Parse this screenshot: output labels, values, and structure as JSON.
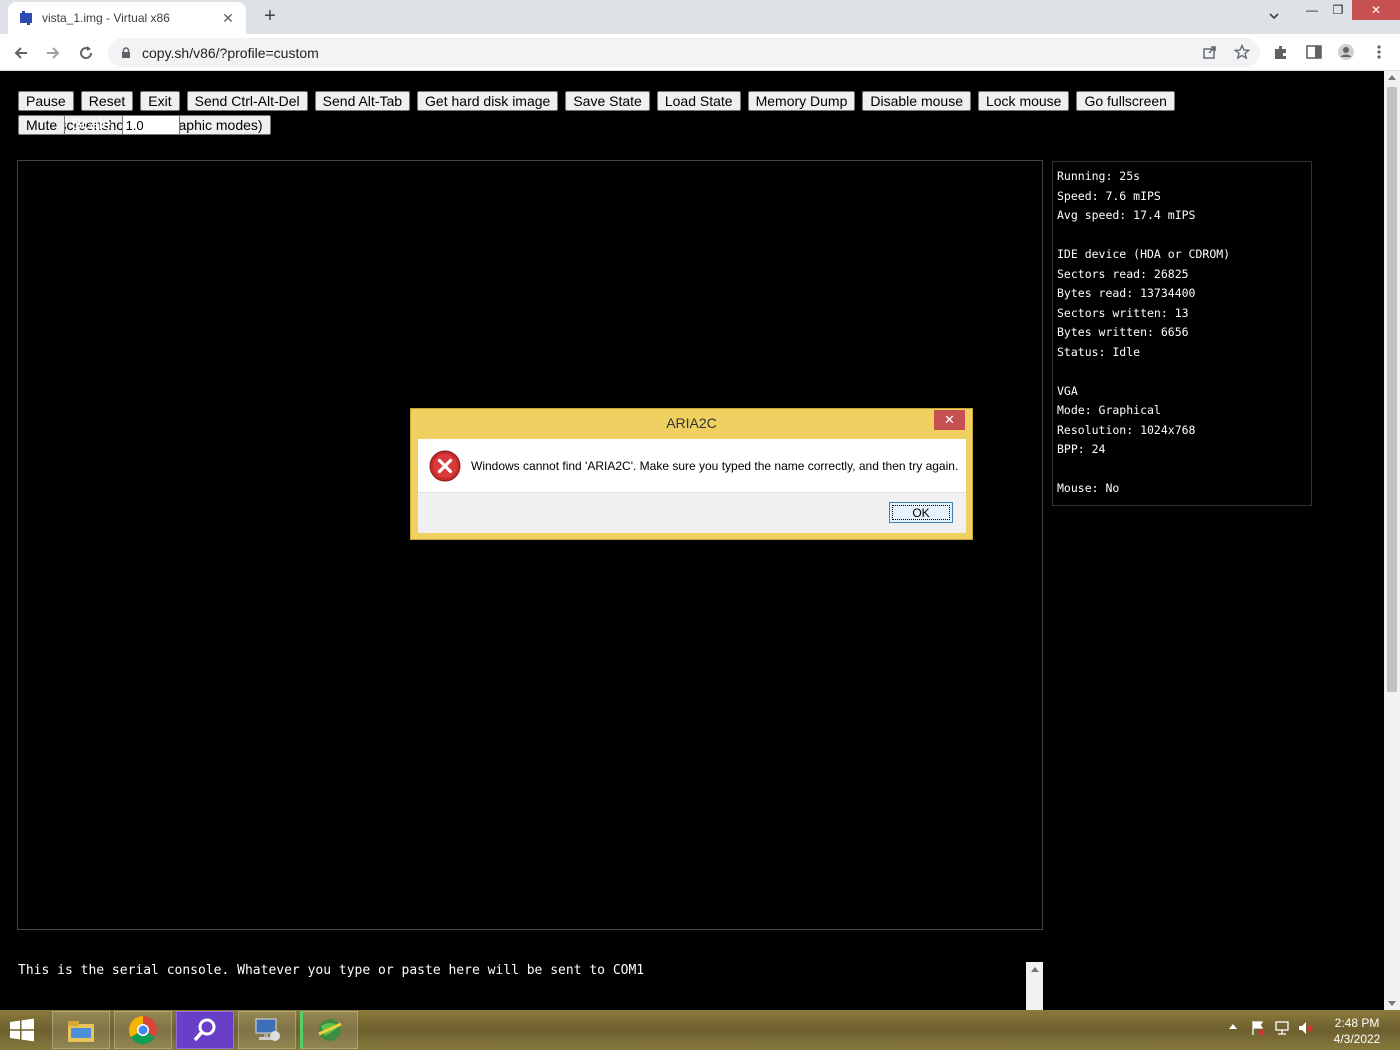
{
  "browser": {
    "tab_title": "vista_1.img - Virtual x86",
    "url": "copy.sh/v86/?profile=custom"
  },
  "emulator": {
    "buttons": [
      "Pause",
      "Reset",
      "Exit",
      "Send Ctrl-Alt-Del",
      "Send Alt-Tab",
      "Get hard disk image",
      "Save State",
      "Load State",
      "Memory Dump",
      "Disable mouse",
      "Lock mouse",
      "Go fullscreen",
      "Take screenshot (only graphic modes)"
    ],
    "mute_label": "Mute",
    "scale_label": "Scale:",
    "scale_value": "1.0"
  },
  "info_panel": {
    "lines": [
      "Running: 25s",
      "Speed: 7.6 mIPS",
      "Avg speed: 17.4 mIPS",
      "",
      "IDE device (HDA or CDROM)",
      "Sectors read: 26825",
      "Bytes read: 13734400",
      "Sectors written: 13",
      "Bytes written: 6656",
      "Status: Idle",
      "",
      "VGA",
      "Mode: Graphical",
      "Resolution: 1024x768",
      "BPP: 24",
      "",
      "Mouse: No"
    ]
  },
  "serial_console": {
    "text": "This is the serial console. Whatever you type or paste here will be sent to COM1"
  },
  "dialog": {
    "title": "ARIA2C",
    "close_label": "✕",
    "message": "Windows cannot find 'ARIA2C'. Make sure you typed the name correctly, and then try again.",
    "ok_label": "OK"
  },
  "taskbar": {
    "time": "2:48 PM",
    "date": "4/3/2022"
  },
  "icons": [
    "tab-favicon-icon",
    "new-tab-icon",
    "back-icon",
    "forward-icon",
    "reload-icon",
    "lock-icon",
    "share-icon",
    "star-icon",
    "extensions-icon",
    "side-panel-icon",
    "profile-icon",
    "menu-icon",
    "error-icon",
    "windows-start-icon",
    "file-explorer-icon",
    "chrome-icon",
    "search-app-icon",
    "network-app-icon",
    "globe-app-icon"
  ]
}
